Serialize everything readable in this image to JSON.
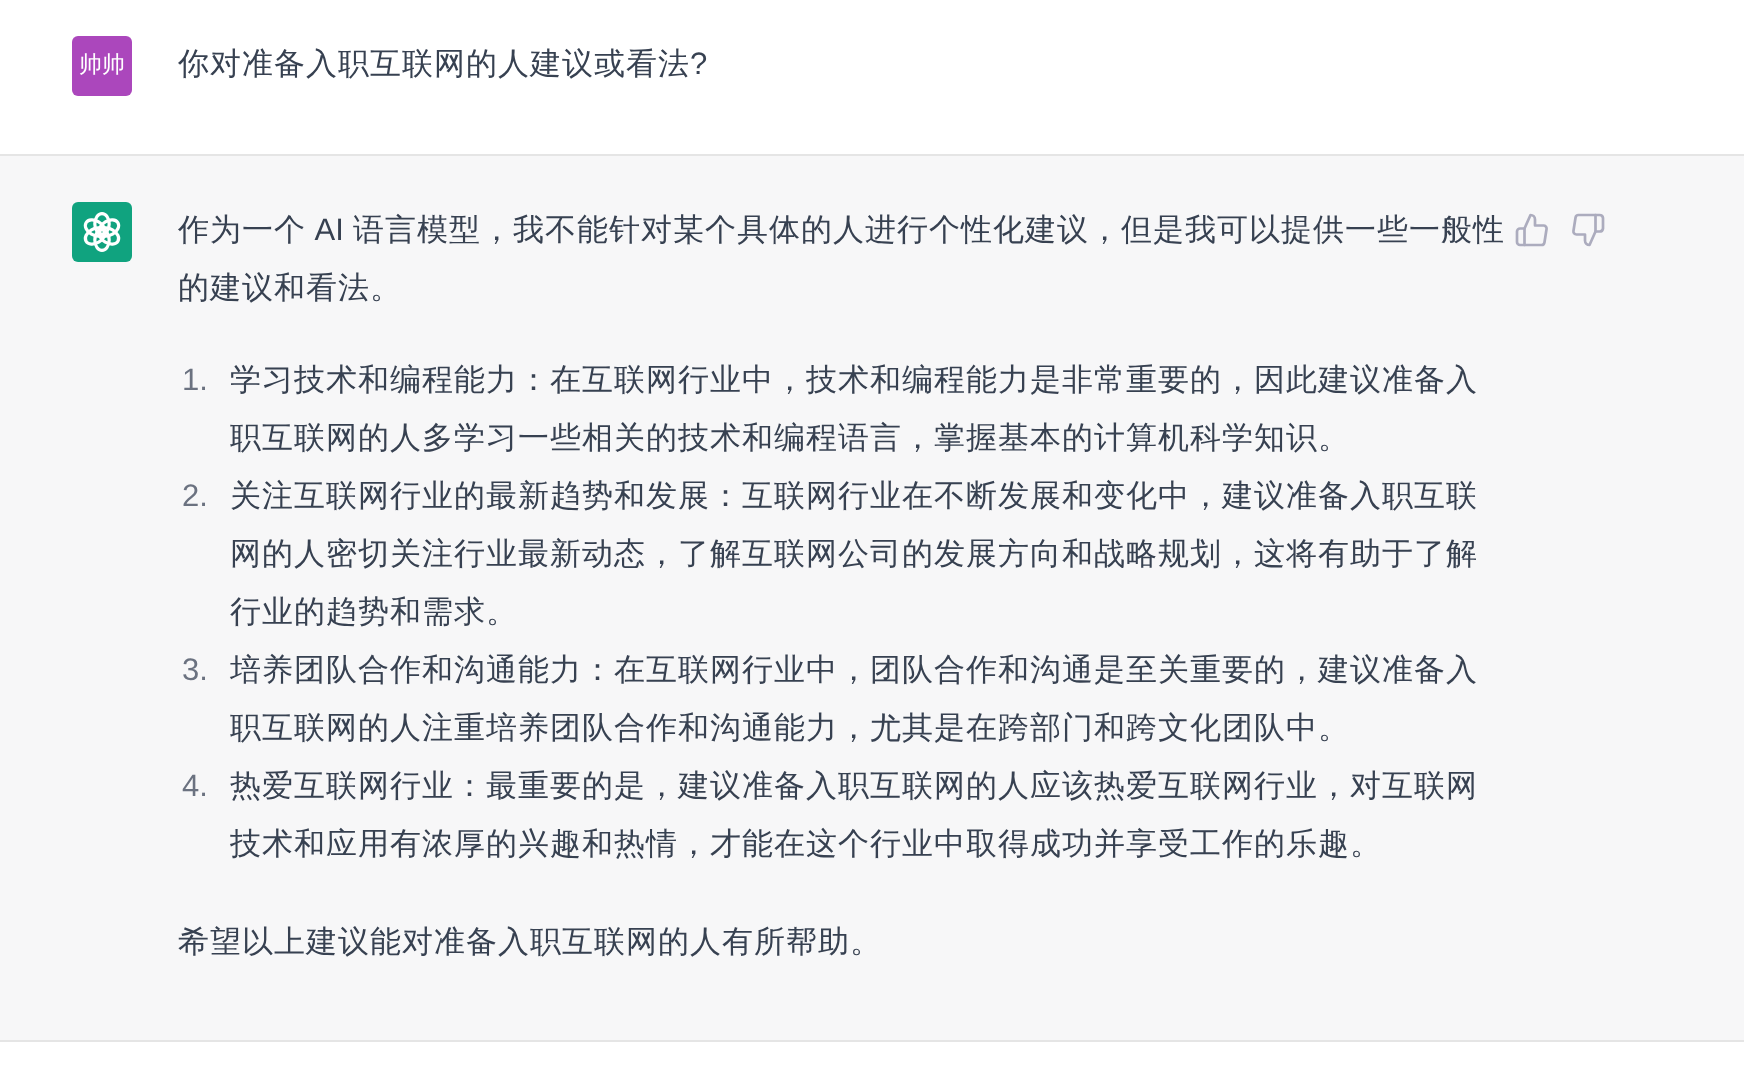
{
  "messages": [
    {
      "kind": "user",
      "avatar_text": "帅帅",
      "blocks": [
        {
          "kind": "paragraph",
          "text": "你对准备入职互联网的人建议或看法?"
        }
      ]
    },
    {
      "kind": "assistant",
      "blocks": [
        {
          "kind": "paragraph",
          "text": "作为一个 AI 语言模型，我不能针对某个具体的人进行个性化建议，但是我可以提供一些一般性的建议和看法。"
        },
        {
          "kind": "list",
          "items": [
            {
              "number": "1.",
              "text": "学习技术和编程能力：在互联网行业中，技术和编程能力是非常重要的，因此建议准备入职互联网的人多学习一些相关的技术和编程语言，掌握基本的计算机科学知识。"
            },
            {
              "number": "2.",
              "text": "关注互联网行业的最新趋势和发展：互联网行业在不断发展和变化中，建议准备入职互联网的人密切关注行业最新动态，了解互联网公司的发展方向和战略规划，这将有助于了解行业的趋势和需求。"
            },
            {
              "number": "3.",
              "text": "培养团队合作和沟通能力：在互联网行业中，团队合作和沟通是至关重要的，建议准备入职互联网的人注重培养团队合作和沟通能力，尤其是在跨部门和跨文化团队中。"
            },
            {
              "number": "4.",
              "text": "热爱互联网行业：最重要的是，建议准备入职互联网的人应该热爱互联网行业，对互联网技术和应用有浓厚的兴趣和热情，才能在这个行业中取得成功并享受工作的乐趣。"
            }
          ]
        },
        {
          "kind": "paragraph",
          "text": "希望以上建议能对准备入职互联网的人有所帮助。"
        }
      ]
    }
  ]
}
